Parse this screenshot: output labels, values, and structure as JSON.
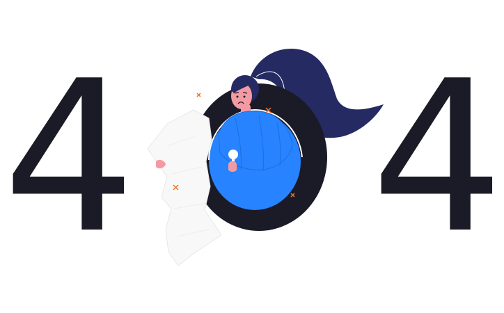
{
  "error_code": {
    "first_digit": "4",
    "last_digit": "4"
  },
  "colors": {
    "digit": "#1b1b27",
    "hair": "#252a62",
    "ring": "#1b1b27",
    "inner_circle": "#2783ff",
    "skin": "#f49aa3",
    "note_paper": "#f8f8f8",
    "note_outline": "#e8e8e8",
    "accent_mark": "#f2702a",
    "lamp": "#ffffff"
  },
  "icons": {
    "person": "character-in-hole-icon",
    "flashlight": "flashlight-icon",
    "paper": "torn-paper-icon",
    "sparkle": "x-sparkle-icon"
  }
}
